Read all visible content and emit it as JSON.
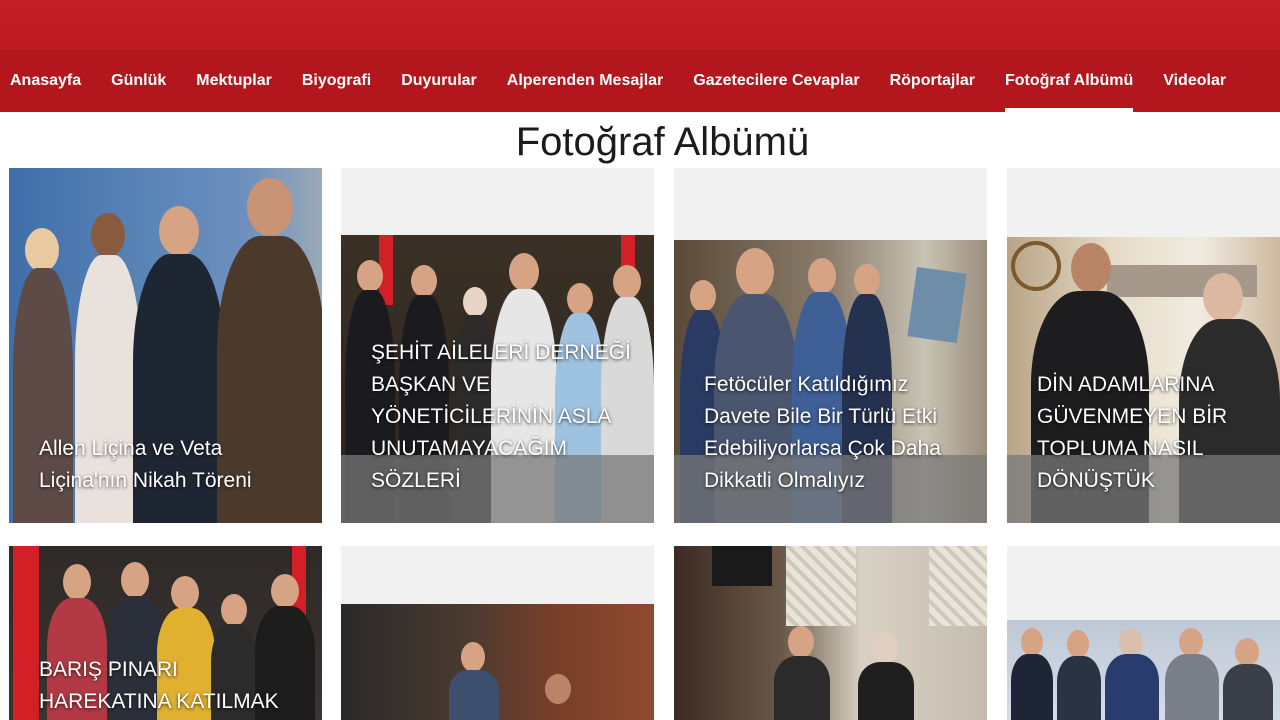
{
  "nav": {
    "items": [
      {
        "label": "Anasayfa"
      },
      {
        "label": "Günlük"
      },
      {
        "label": "Mektuplar"
      },
      {
        "label": "Biyografi"
      },
      {
        "label": "Duyurular"
      },
      {
        "label": "Alperenden Mesajlar"
      },
      {
        "label": "Gazetecilere Cevaplar"
      },
      {
        "label": "Röportajlar"
      },
      {
        "label": "Fotoğraf Albümü"
      },
      {
        "label": "Videolar"
      }
    ],
    "active_index": 8
  },
  "page": {
    "title": "Fotoğraf Albümü"
  },
  "albums": [
    {
      "caption": "Allen Liçina ve Veta Liçina'nın Nikah Töreni"
    },
    {
      "caption": "ŞEHİT AİLELERİ DERNEĞİ BAŞKAN VE YÖNETİCİLERİNİN ASLA UNUTAMAYACAĞIM SÖZLERİ"
    },
    {
      "caption": "Fetöcüler Katıldığımız Davete Bile Bir Türlü Etki Edebiliyorlarsa Çok Daha Dikkatli Olmalıyız"
    },
    {
      "caption": "DİN ADAMLARINA GÜVENMEYEN BİR TOPLUMA NASIL DÖNÜŞTÜK"
    },
    {
      "caption": "BARIŞ PINARI HAREKATINA KATILMAK"
    },
    {
      "caption": ""
    },
    {
      "caption": ""
    },
    {
      "caption": ""
    }
  ],
  "colors": {
    "header_red": "#b3161c",
    "nav_text": "#ffffff",
    "title_text": "#1b1b1b",
    "caption_shade": "#787878"
  }
}
